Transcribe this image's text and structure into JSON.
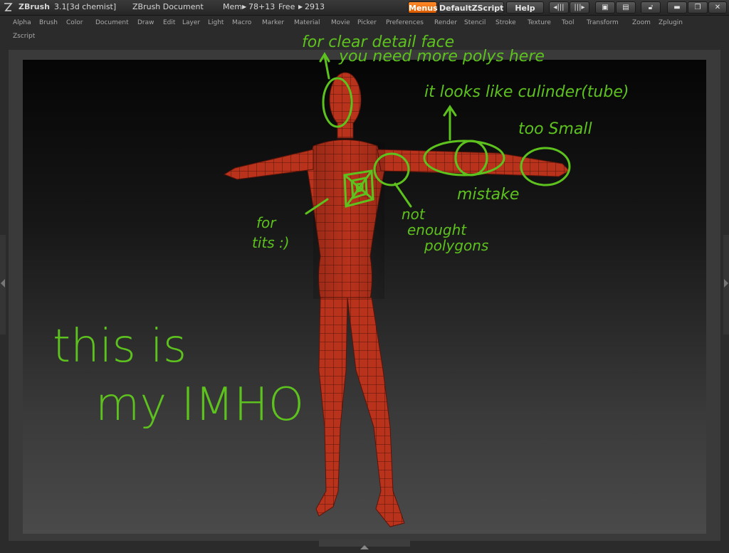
{
  "title_bar": {
    "app_name": "ZBrush",
    "version_user": "3.1[3d chemist]",
    "document_label": "ZBrush Document",
    "mem_label": "Mem",
    "mem_value": "78+13",
    "free_label": "Free",
    "free_value": "2913",
    "menus_button": "Menus",
    "script_button": "DefaultZScript",
    "help_button": "Help"
  },
  "menu_bar": {
    "items": [
      "Alpha",
      "Brush",
      "Color",
      "Document",
      "Draw",
      "Edit",
      "Layer",
      "Light",
      "Macro",
      "Marker",
      "Material",
      "Movie",
      "Picker",
      "Preferences",
      "Render",
      "Stencil",
      "Stroke",
      "Texture",
      "Tool",
      "Transform",
      "Zoom",
      "Zplugin",
      "Zscript"
    ]
  },
  "annotations": {
    "face_note_1": "for clear detail face",
    "face_note_2": "you need more polys here",
    "arm_note": "it looks like culinder(tube)",
    "hand_note": "too Small",
    "mistake_note": "mistake",
    "chest_note_1": "for",
    "chest_note_2": "tits :)",
    "poly_note_1": "not",
    "poly_note_2": "enought",
    "poly_note_3": "polygons",
    "opinion_1": "this is",
    "opinion_2": "my IMHO"
  },
  "colors": {
    "accent": "#e86e10",
    "annotation_green": "#5dc21e",
    "model_red": "#b8321c"
  },
  "icons": [
    "zbrush-logo-icon",
    "dock-left-icon",
    "dock-right-icon",
    "undock-icon",
    "float-icon",
    "lock-icon",
    "minimize-icon",
    "restore-icon",
    "close-icon"
  ]
}
